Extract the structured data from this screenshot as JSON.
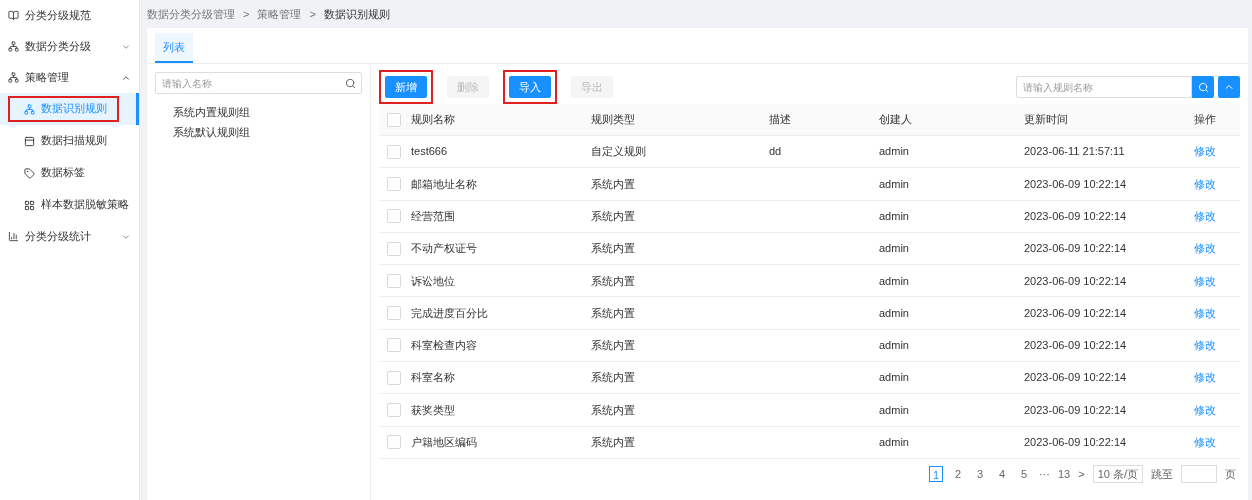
{
  "sidebar": {
    "items": [
      {
        "label": "分类分级规范"
      },
      {
        "label": "数据分类分级",
        "expanded": false
      },
      {
        "label": "策略管理",
        "expanded": true,
        "children": [
          {
            "label": "数据识别规则",
            "selected": true,
            "annotated": true
          },
          {
            "label": "数据扫描规则",
            "selected": false,
            "annotated": false
          },
          {
            "label": "数据标签",
            "selected": false,
            "annotated": false
          },
          {
            "label": "样本数据脱敏策略",
            "selected": false,
            "annotated": false
          }
        ]
      },
      {
        "label": "分类分级统计",
        "expanded": false
      }
    ]
  },
  "breadcrumb": {
    "items": [
      "数据分类分级管理",
      "策略管理",
      "数据识别规则"
    ],
    "separator": ">"
  },
  "tabs": [
    {
      "label": "列表",
      "selected": true
    }
  ],
  "tree": {
    "search_placeholder": "请输入名称",
    "groups": [
      "系统内置规则组",
      "系统默认规则组"
    ]
  },
  "toolbar": {
    "buttons": [
      {
        "label": "新增",
        "disabled": false,
        "annotated": true
      },
      {
        "label": "删除",
        "disabled": true,
        "annotated": false
      },
      {
        "label": "导入",
        "disabled": false,
        "annotated": true
      },
      {
        "label": "导出",
        "disabled": true,
        "annotated": false
      }
    ],
    "search_placeholder": "请输入规则名称"
  },
  "table": {
    "select_all_checked": false,
    "columns": [
      "规则名称",
      "规则类型",
      "描述",
      "创建人",
      "更新时间",
      "操作"
    ],
    "rows": [
      {
        "checked": false,
        "cells": [
          "test666",
          "自定义规则",
          "dd",
          "admin",
          "2023-06-11 21:57:11"
        ],
        "action": "修改"
      },
      {
        "checked": false,
        "cells": [
          "邮箱地址名称",
          "系统内置",
          "",
          "admin",
          "2023-06-09 10:22:14"
        ],
        "action": "修改"
      },
      {
        "checked": false,
        "cells": [
          "经营范围",
          "系统内置",
          "",
          "admin",
          "2023-06-09 10:22:14"
        ],
        "action": "修改"
      },
      {
        "checked": false,
        "cells": [
          "不动产权证号",
          "系统内置",
          "",
          "admin",
          "2023-06-09 10:22:14"
        ],
        "action": "修改"
      },
      {
        "checked": false,
        "cells": [
          "诉讼地位",
          "系统内置",
          "",
          "admin",
          "2023-06-09 10:22:14"
        ],
        "action": "修改"
      },
      {
        "checked": false,
        "cells": [
          "完成进度百分比",
          "系统内置",
          "",
          "admin",
          "2023-06-09 10:22:14"
        ],
        "action": "修改"
      },
      {
        "checked": false,
        "cells": [
          "科室检查内容",
          "系统内置",
          "",
          "admin",
          "2023-06-09 10:22:14"
        ],
        "action": "修改"
      },
      {
        "checked": false,
        "cells": [
          "科室名称",
          "系统内置",
          "",
          "admin",
          "2023-06-09 10:22:14"
        ],
        "action": "修改"
      },
      {
        "checked": false,
        "cells": [
          "获奖类型",
          "系统内置",
          "",
          "admin",
          "2023-06-09 10:22:14"
        ],
        "action": "修改"
      },
      {
        "checked": false,
        "cells": [
          "户籍地区编码",
          "系统内置",
          "",
          "admin",
          "2023-06-09 10:22:14"
        ],
        "action": "修改"
      }
    ]
  },
  "pagination": {
    "pages": [
      {
        "label": "1",
        "selected": true
      },
      {
        "label": "2",
        "selected": false
      },
      {
        "label": "3",
        "selected": false
      },
      {
        "label": "4",
        "selected": false
      },
      {
        "label": "5",
        "selected": false
      }
    ],
    "ellipsis": "···",
    "last": "13",
    "next": ">",
    "page_size": "10 条/页",
    "jump_label": "跳至",
    "jump_suffix": "页"
  }
}
